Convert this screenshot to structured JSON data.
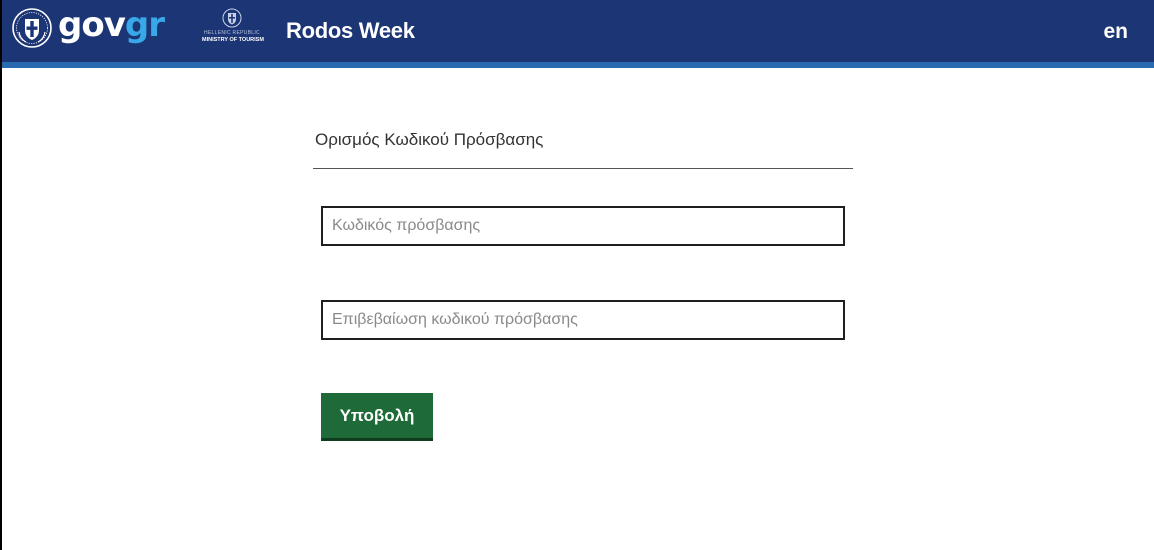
{
  "header": {
    "logo_text_gov": "gov",
    "logo_text_gr": "gr",
    "ministry_line1": "HELLENIC REPUBLIC",
    "ministry_line2": "MINISTRY OF TOURISM",
    "app_title": "Rodos Week",
    "language": "en",
    "colors": {
      "bar": "#1c3575",
      "accent": "#2a6ab0",
      "logo_gr": "#38a8e8"
    },
    "icons": {
      "govgr_emblem": "greek-emblem-icon",
      "ministry_emblem": "ministry-emblem-icon"
    }
  },
  "form": {
    "title": "Ορισμός Κωδικού Πρόσβασης",
    "password_placeholder": "Κωδικός πρόσβασης",
    "password_value": "",
    "confirm_placeholder": "Επιβεβαίωση κωδικού πρόσβασης",
    "confirm_value": "",
    "submit_label": "Υποβολή",
    "submit_color": "#1e6b39"
  }
}
